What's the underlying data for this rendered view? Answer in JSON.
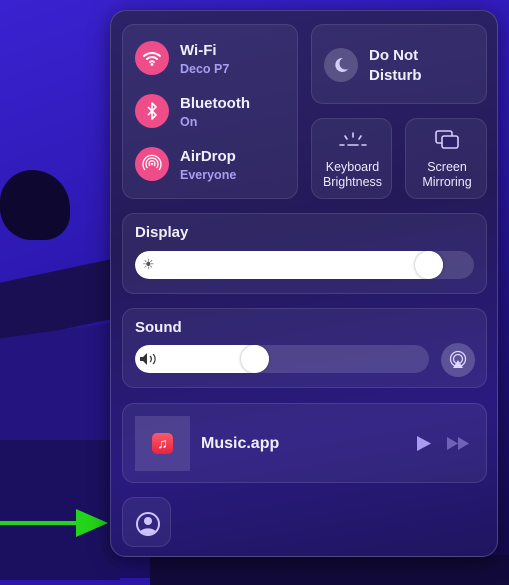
{
  "network": [
    {
      "title": "Wi-Fi",
      "subtitle": "Deco P7",
      "icon": "wifi-icon"
    },
    {
      "title": "Bluetooth",
      "subtitle": "On",
      "icon": "bluetooth-icon"
    },
    {
      "title": "AirDrop",
      "subtitle": "Everyone",
      "icon": "airdrop-icon"
    }
  ],
  "focus": {
    "label_line1": "Do Not",
    "label_line2": "Disturb",
    "icon": "moon-icon"
  },
  "keyboard": {
    "line1": "Keyboard",
    "line2": "Brightness",
    "icon": "keyboard-brightness-icon"
  },
  "mirroring": {
    "line1": "Screen",
    "line2": "Mirroring",
    "icon": "screen-mirroring-icon"
  },
  "display": {
    "title": "Display",
    "brightness_percent": 90,
    "icon": "sun-icon"
  },
  "sound": {
    "title": "Sound",
    "volume_percent": 40,
    "icon": "speaker-icon",
    "output_icon": "airplay-audio-icon"
  },
  "now_playing": {
    "app": "Music.app",
    "icon": "music-app-icon"
  },
  "colors": {
    "accent": "#ef4d8a",
    "annotation_arrow": "#22d41a"
  }
}
